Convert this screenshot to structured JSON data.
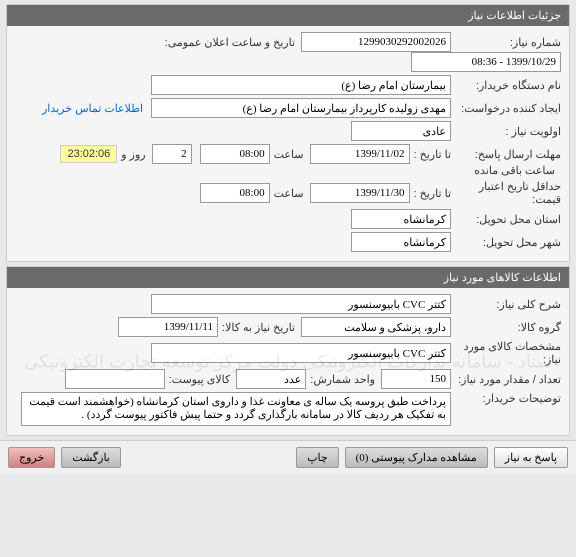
{
  "panel1": {
    "title": "جزئیات اطلاعات نیاز",
    "niaz_number_label": "شماره نیاز:",
    "niaz_number": "1299030292002026",
    "public_datetime_label": "تاریخ و ساعت اعلان عمومی:",
    "public_datetime": "1399/10/29 - 08:36",
    "buyer_label": "نام دستگاه خریدار:",
    "buyer": "بیمارستان امام رضا (ع)",
    "creator_label": "ایجاد کننده درخواست:",
    "creator": "مهدی زولیده کارپرداز بیمارستان امام رضا (ع)",
    "contact_link": "اطلاعات تماس خریدار",
    "priority_label": "اولویت نیاز :",
    "priority": "عادی",
    "deadline_label": "مهلت ارسال پاسخ:",
    "to_date_label": "تا تاریخ :",
    "deadline_date": "1399/11/02",
    "time_label": "ساعت",
    "deadline_time": "08:00",
    "days": "2",
    "days_label": "روز و",
    "countdown": "23:02:06",
    "remaining_label": "ساعت باقی مانده",
    "min_validity_label": "حداقل تاریخ اعتبار قیمت:",
    "validity_date": "1399/11/30",
    "validity_time": "08:00",
    "delivery_province_label": "استان محل تحویل:",
    "delivery_province": "کرمانشاه",
    "delivery_city_label": "شهر محل تحویل:",
    "delivery_city": "کرمانشاه"
  },
  "panel2": {
    "title": "اطلاعات کالاهای مورد نیاز",
    "desc_label": "شرح کلی نیاز:",
    "desc": "کتتر CVC بابیوسنسور",
    "group_label": "گروه کالا:",
    "group": "دارو، پزشکی و سلامت",
    "need_date_label": "تاریخ نیاز به کالا:",
    "need_date": "1399/11/11",
    "spec_label": "مشخصات کالای مورد نیاز:",
    "spec": "کتتر CVC بابیوسنسور",
    "qty_label": "تعداد / مقدار مورد نیاز:",
    "qty": "150",
    "unit_label": "واحد شمارش:",
    "unit": "عدد",
    "attach_label": "کالای پیوست:",
    "buyer_note_label": "توضیحات خریدار:",
    "buyer_note": "پرداخت طبق پروسه یک ساله ی معاونت غذا و داروی استان کرمانشاه (خواهشمند است قیمت به تفکیک هر ردیف کالا در سامانه بارگذاری گردد و حتما پیش فاکتور پیوست گردد) ."
  },
  "footer": {
    "reply": "پاسخ به نیاز",
    "attachments": "مشاهده مدارک پیوستی",
    "attach_count": "(0)",
    "print": "چاپ",
    "back": "بازگشت",
    "exit": "خروج"
  },
  "watermark": "ستاد - سامانه تدارکات الکترونیکی دولت\nمرکز توسعه تجارت الکترونیکی"
}
